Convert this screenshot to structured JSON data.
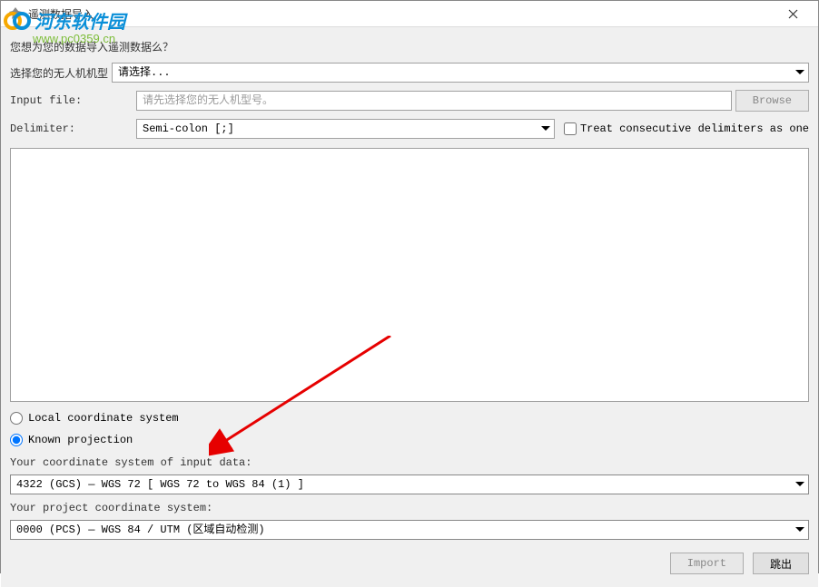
{
  "window": {
    "title": "遥测数据导入"
  },
  "question_text": "您想为您的数据导入遥测数据么？",
  "model_row": {
    "label": "选择您的无人机机型",
    "selected": "请选择..."
  },
  "input_file_row": {
    "label": "Input file:",
    "placeholder": "请先选择您的无人机型号。",
    "browse_label": "Browse"
  },
  "delimiter_row": {
    "label": "Delimiter:",
    "selected": "Semi-colon [;]",
    "checkbox_label": "Treat consecutive delimiters as one"
  },
  "radio_options": {
    "local": "Local coordinate system",
    "known": "Known projection"
  },
  "coord_input": {
    "label": "Your coordinate system of input data:",
    "selected": "4322 (GCS) — WGS 72 [ WGS 72 to WGS 84 (1) ]"
  },
  "coord_project": {
    "label": "Your project coordinate system:",
    "selected": "0000 (PCS) — WGS 84 / UTM (区域自动检测)"
  },
  "buttons": {
    "import": "Import",
    "skip": "跳出"
  },
  "watermark": {
    "text": "河东软件园",
    "url": "www.pc0359.cn"
  }
}
